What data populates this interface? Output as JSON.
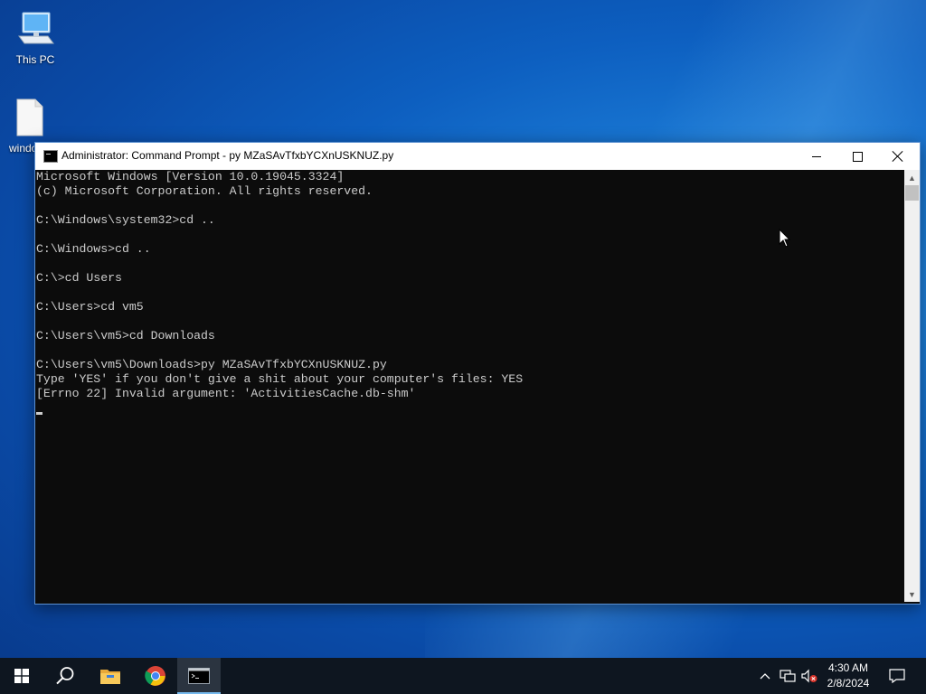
{
  "desktop": {
    "icons": [
      {
        "label": "This PC",
        "icon": "computer-icon"
      },
      {
        "label": "windo",
        "icon": "file-icon"
      }
    ]
  },
  "window": {
    "title": "Administrator: Command Prompt - py  MZaSAvTfxbYCXnUSKNUZ.py",
    "console_lines": [
      "Microsoft Windows [Version 10.0.19045.3324]",
      "(c) Microsoft Corporation. All rights reserved.",
      "",
      "C:\\Windows\\system32>cd ..",
      "",
      "C:\\Windows>cd ..",
      "",
      "C:\\>cd Users",
      "",
      "C:\\Users>cd vm5",
      "",
      "C:\\Users\\vm5>cd Downloads",
      "",
      "C:\\Users\\vm5\\Downloads>py MZaSAvTfxbYCXnUSKNUZ.py",
      "Type 'YES' if you don't give a shit about your computer's files: YES",
      "[Errno 22] Invalid argument: 'ActivitiesCache.db-shm'"
    ]
  },
  "taskbar": {
    "items": [
      "start-icon",
      "search-icon",
      "file-explorer-icon",
      "chrome-icon",
      "command-prompt-icon"
    ],
    "tray_icons": [
      "chevron-up-icon",
      "network-icon",
      "volume-muted-icon",
      "notifications-icon"
    ],
    "time": "4:30 AM",
    "date": "2/8/2024"
  }
}
